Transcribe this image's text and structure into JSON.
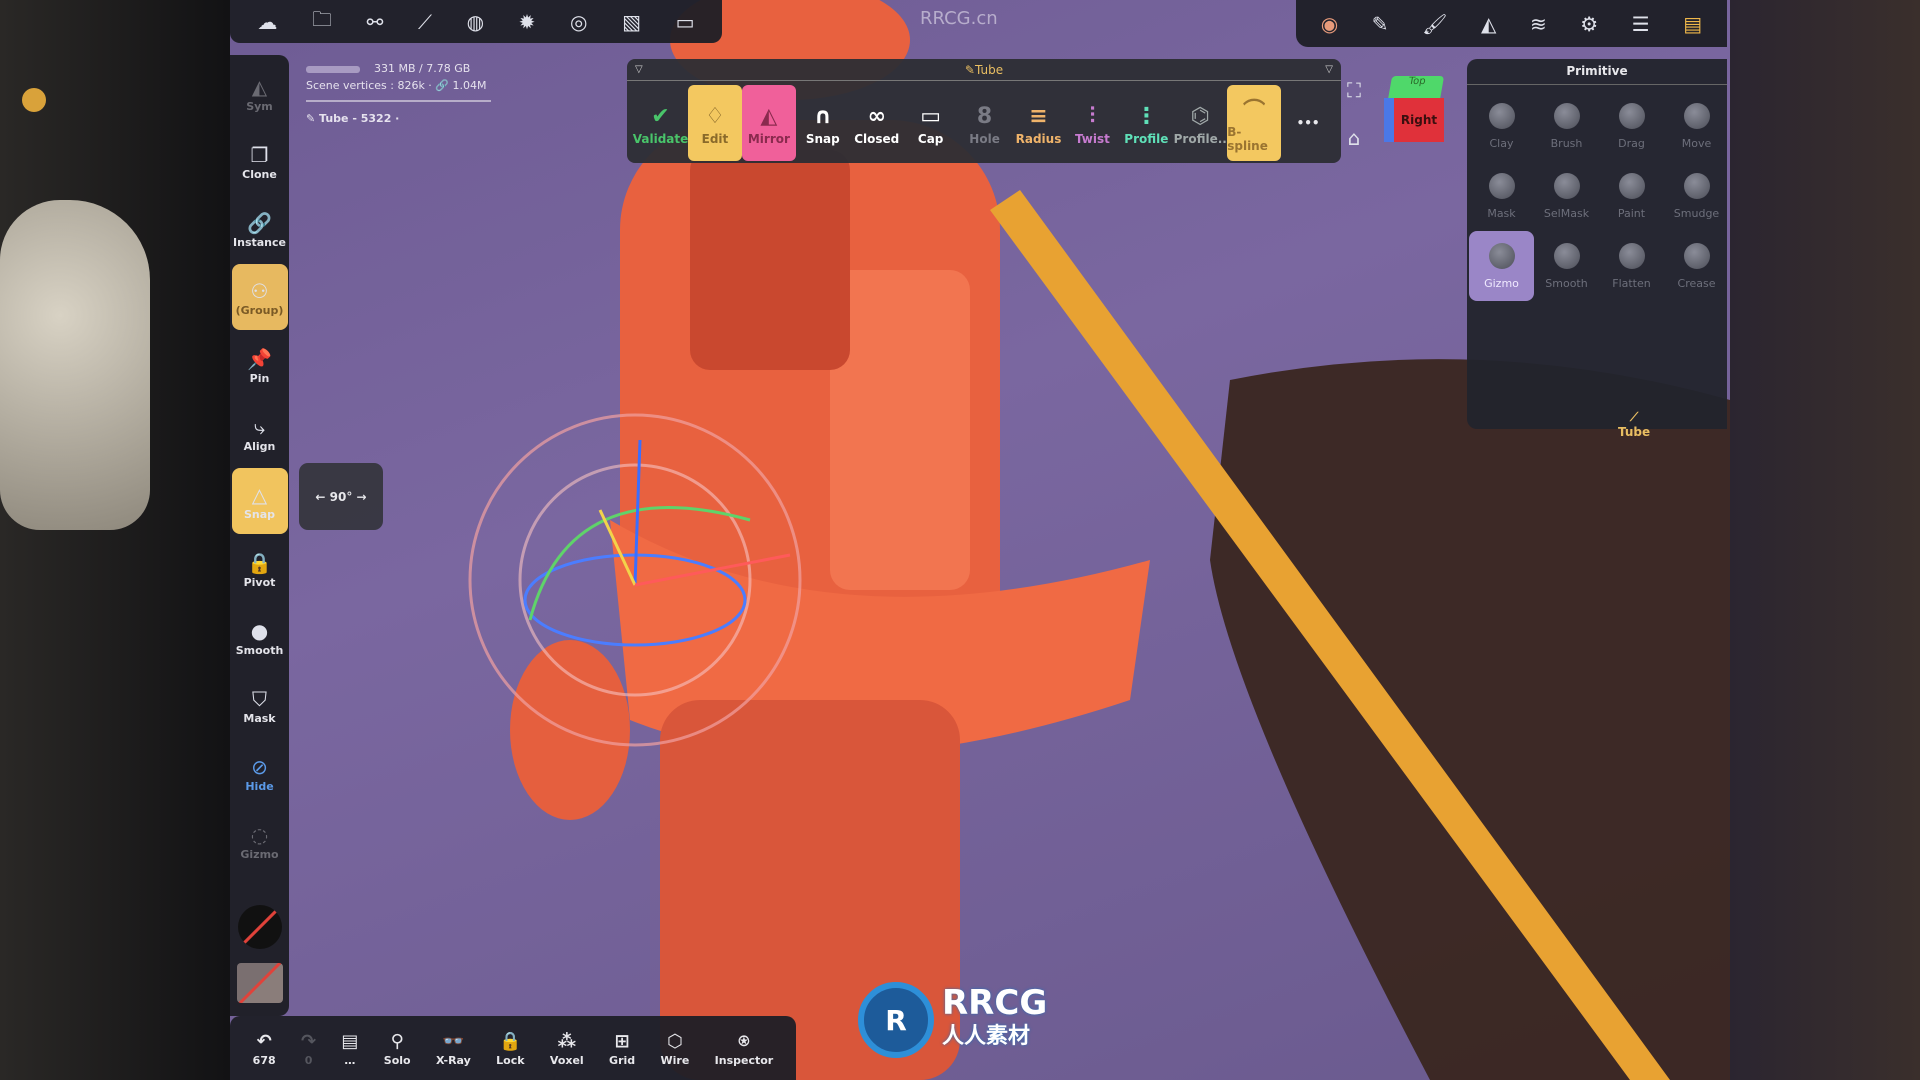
{
  "watermark_top": "RRCG.cn",
  "top_left_icons": [
    "cloud-icon",
    "folder-icon",
    "share-nodes-icon",
    "brush-stroke-icon",
    "globe-icon",
    "sun-icon",
    "material-icon",
    "image-icon",
    "video-camera-icon"
  ],
  "top_right_icons": [
    "gizmo-tool-icon",
    "pen-icon",
    "brush-icon",
    "symmetry-icon",
    "layers-icon",
    "settings-icon",
    "sliders-icon",
    "toolbox-icon"
  ],
  "info": {
    "memory": "331 MB / 7.78 GB",
    "vertices": "Scene vertices : 826k · 🔗 1.04M",
    "object": "Tube - 5322 ·"
  },
  "sidebar": [
    {
      "label": "Sym",
      "icon": "symmetry-icon",
      "state": "dim"
    },
    {
      "label": "Clone",
      "icon": "clone-icon"
    },
    {
      "label": "Instance",
      "icon": "link-icon"
    },
    {
      "label": "(Group)",
      "icon": "group-icon",
      "state": "active"
    },
    {
      "label": "Pin",
      "icon": "pin-icon"
    },
    {
      "label": "Align",
      "icon": "align-icon"
    },
    {
      "label": "Snap",
      "icon": "snap-triangle-icon",
      "state": "snap"
    },
    {
      "label": "Pivot",
      "icon": "lock-icon"
    },
    {
      "label": "Smooth",
      "icon": "smooth-sphere-icon"
    },
    {
      "label": "Mask",
      "icon": "mask-shield-icon"
    },
    {
      "label": "Hide",
      "icon": "hide-icon",
      "state": "hide"
    },
    {
      "label": "Gizmo",
      "icon": "gizmo-icon",
      "state": "dim"
    }
  ],
  "angle": "← 90° →",
  "tube_panel": {
    "title": "Tube",
    "tools": [
      {
        "label": "Validate",
        "color": "#49c46a",
        "bg": ""
      },
      {
        "label": "Edit",
        "color": "#8a6a2a",
        "bg": "#f3c860"
      },
      {
        "label": "Mirror",
        "color": "#8a2a4e",
        "bg": "#f0609a"
      },
      {
        "label": "Snap",
        "color": "#ffffff",
        "bg": ""
      },
      {
        "label": "Closed",
        "color": "#ffffff",
        "bg": ""
      },
      {
        "label": "Cap",
        "color": "#ffffff",
        "bg": ""
      },
      {
        "label": "Hole",
        "color": "#7a7b85",
        "bg": ""
      },
      {
        "label": "Radius",
        "color": "#efb36a",
        "bg": ""
      },
      {
        "label": "Twist",
        "color": "#c77bd0",
        "bg": ""
      },
      {
        "label": "Profile",
        "color": "#5fe0b8",
        "bg": ""
      },
      {
        "label": "Profile..",
        "color": "#a0a8a8",
        "bg": ""
      },
      {
        "label": "B-spline",
        "color": "#9a7430",
        "bg": "#f3c860"
      }
    ],
    "more": "•••"
  },
  "view_cube": {
    "face": "Right",
    "top": "Top"
  },
  "primitive": {
    "title": "Primitive",
    "items": [
      "Clay",
      "Brush",
      "Drag",
      "Move",
      "Mask",
      "SelMask",
      "Paint",
      "Smudge",
      "Gizmo",
      "Smooth",
      "Flatten",
      "Crease"
    ],
    "active": "Gizmo",
    "selected_label": "Tube"
  },
  "bottom": [
    {
      "label": "678",
      "icon": "undo-icon"
    },
    {
      "label": "0",
      "icon": "redo-icon"
    },
    {
      "label": "…",
      "icon": "scene-list-icon"
    },
    {
      "label": "Solo",
      "icon": "search-icon"
    },
    {
      "label": "X-Ray",
      "icon": "glasses-icon"
    },
    {
      "label": "Lock",
      "icon": "lock-icon"
    },
    {
      "label": "Voxel",
      "icon": "voxel-icon"
    },
    {
      "label": "Grid",
      "icon": "grid-icon"
    },
    {
      "label": "Wire",
      "icon": "wire-icon"
    },
    {
      "label": "Inspector",
      "icon": "inspector-icon"
    }
  ],
  "logo": {
    "name": "RRCG",
    "sub": "人人素材"
  }
}
